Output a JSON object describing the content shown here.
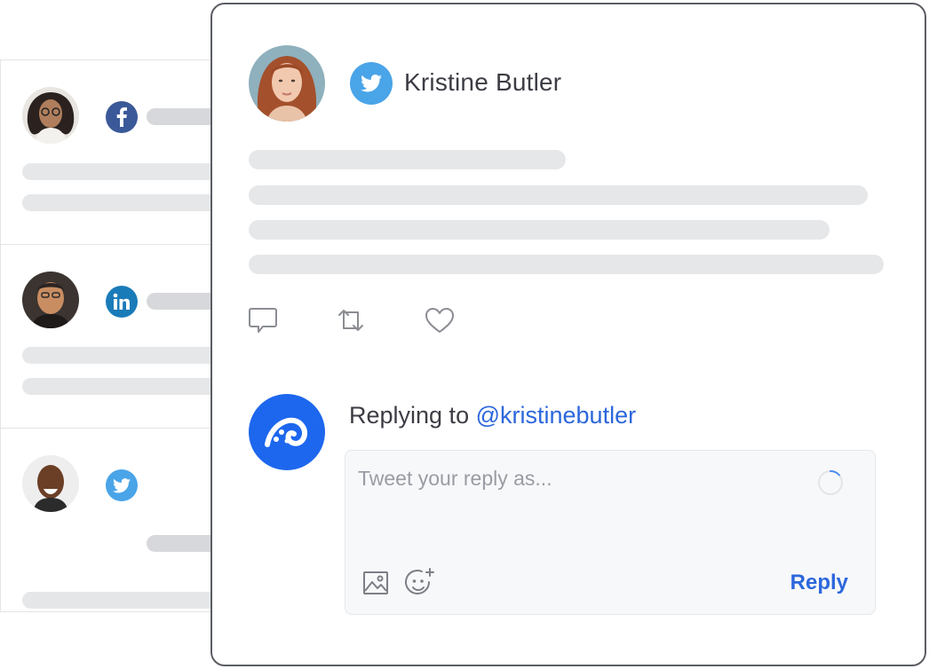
{
  "feed": {
    "items": [
      {
        "network": "facebook",
        "network_icon": "facebook-icon",
        "color": "#3b5998"
      },
      {
        "network": "linkedin",
        "network_icon": "linkedin-icon",
        "color": "#1a7bb9"
      },
      {
        "network": "twitter",
        "network_icon": "twitter-icon",
        "color": "#4aa4e8"
      }
    ]
  },
  "post": {
    "author": "Kristine Butler",
    "network": "twitter",
    "actions": [
      {
        "icon": "comment-icon"
      },
      {
        "icon": "retweet-icon"
      },
      {
        "icon": "heart-icon"
      }
    ]
  },
  "reply": {
    "replying_prefix": "Replying to",
    "handle": "@kristinebutler",
    "placeholder": "Tweet your reply as...",
    "submit_label": "Reply",
    "tools": [
      {
        "icon": "image-icon"
      },
      {
        "icon": "add-emoji-icon"
      }
    ]
  },
  "colors": {
    "accent": "#2c67dc",
    "brand_logo": "#1d67ee",
    "twitter": "#4aa4e8",
    "border": "#5b5d63",
    "placeholder_bar": "#e6e7e9"
  }
}
